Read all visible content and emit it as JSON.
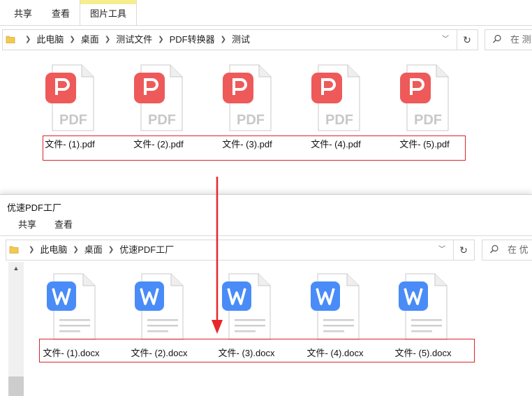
{
  "top": {
    "ribbon": {
      "tabs": [
        "共享",
        "查看",
        "图片工具"
      ]
    },
    "breadcrumb": [
      "此电脑",
      "桌面",
      "测试文件",
      "PDF转换器",
      "测试"
    ],
    "search_placeholder": "在 测",
    "files": [
      "文件- (1).pdf",
      "文件- (2).pdf",
      "文件- (3).pdf",
      "文件- (4).pdf",
      "文件- (5).pdf"
    ],
    "file_badge": "PDF"
  },
  "bottom": {
    "title": "优速PDF工厂",
    "ribbon": {
      "tabs": [
        "共享",
        "查看"
      ]
    },
    "breadcrumb": [
      "此电脑",
      "桌面",
      "优速PDF工厂"
    ],
    "search_placeholder": "在 优",
    "files": [
      "文件- (1).docx",
      "文件- (2).docx",
      "文件- (3).docx",
      "文件- (4).docx",
      "文件- (5).docx"
    ],
    "file_badge": "W"
  },
  "colors": {
    "pdf_red": "#ee5a5a",
    "word_blue": "#4a8cf7",
    "highlight_red": "#d8262b",
    "arrow_red": "#e8262b"
  },
  "icons": {
    "folder": "folder-icon",
    "search": "search-icon",
    "refresh": "refresh-icon",
    "dropdown": "chevron-down-icon",
    "arrow": "down-arrow-annotation"
  }
}
